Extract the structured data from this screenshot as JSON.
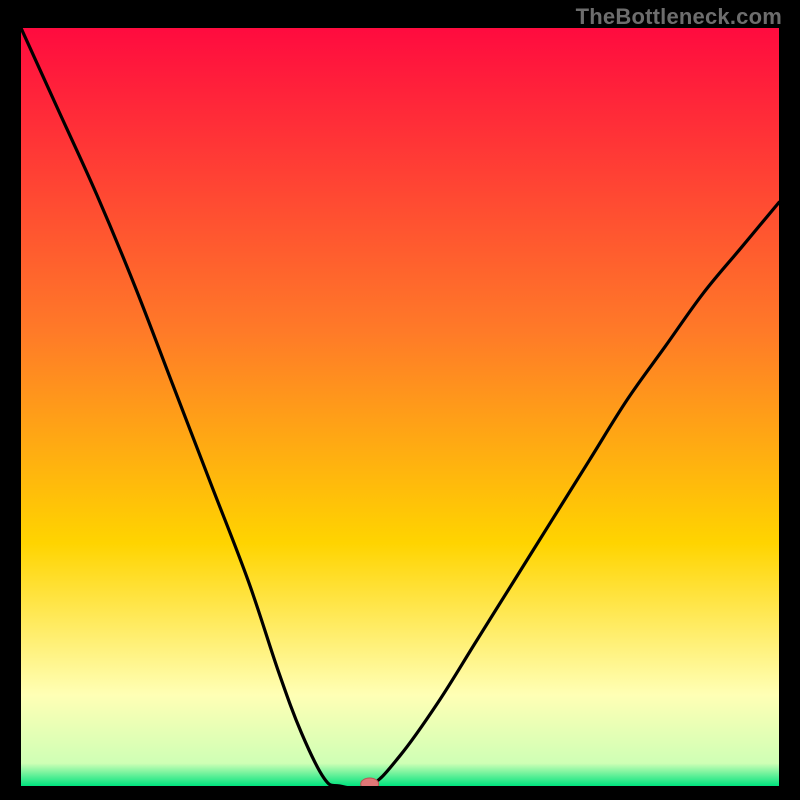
{
  "watermark": "TheBottleneck.com",
  "colors": {
    "frame_bg": "#000000",
    "grad_top": "#ff0b3f",
    "grad_mid1": "#ff7a28",
    "grad_mid2": "#ffd400",
    "grad_pale": "#ffffb5",
    "grad_green": "#00e37e",
    "curve": "#000000",
    "marker_fill": "#e07777",
    "marker_stroke": "#b85555"
  },
  "chart_data": {
    "type": "line",
    "title": "",
    "xlabel": "",
    "ylabel": "",
    "x_range": [
      0,
      100
    ],
    "y_range": [
      0,
      100
    ],
    "series": [
      {
        "name": "curve-left",
        "x": [
          0,
          5,
          10,
          15,
          20,
          25,
          30,
          34,
          37,
          40,
          42
        ],
        "y": [
          100,
          89,
          78,
          66,
          53,
          40,
          27,
          15,
          7,
          1,
          0
        ]
      },
      {
        "name": "curve-flat",
        "x": [
          42,
          46
        ],
        "y": [
          0,
          0
        ]
      },
      {
        "name": "curve-right",
        "x": [
          46,
          50,
          55,
          60,
          65,
          70,
          75,
          80,
          85,
          90,
          95,
          100
        ],
        "y": [
          0,
          4,
          11,
          19,
          27,
          35,
          43,
          51,
          58,
          65,
          71,
          77
        ]
      }
    ],
    "marker": {
      "x": 46,
      "y": 0
    },
    "gradient_stops": [
      {
        "offset": 0.0,
        "color": "#ff0b3f"
      },
      {
        "offset": 0.4,
        "color": "#ff7a28"
      },
      {
        "offset": 0.68,
        "color": "#ffd400"
      },
      {
        "offset": 0.88,
        "color": "#ffffb5"
      },
      {
        "offset": 0.97,
        "color": "#cfffb5"
      },
      {
        "offset": 1.0,
        "color": "#00e37e"
      }
    ]
  }
}
